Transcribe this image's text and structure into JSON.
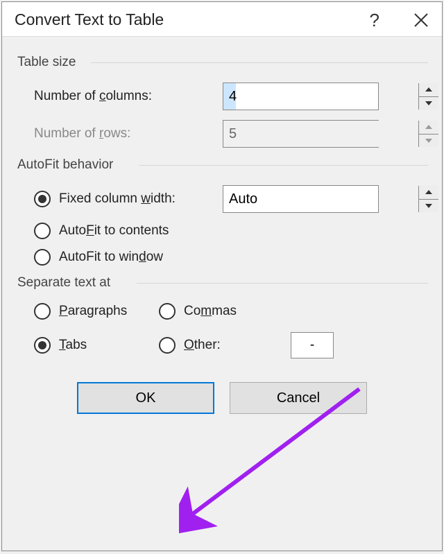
{
  "title": "Convert Text to Table",
  "groups": {
    "table_size": {
      "label": "Table size",
      "columns_label_parts": [
        "Number of ",
        "c",
        "olumns:"
      ],
      "columns_value": "4",
      "rows_label_parts": [
        "Number of ",
        "r",
        "ows:"
      ],
      "rows_value": "5"
    },
    "autofit": {
      "label": "AutoFit behavior",
      "fixed_label_parts": [
        "Fixed column ",
        "w",
        "idth:"
      ],
      "fixed_value": "Auto",
      "contents_label_parts": [
        "Auto",
        "F",
        "it to contents"
      ],
      "window_label_parts": [
        "AutoFit to win",
        "d",
        "ow"
      ]
    },
    "separate": {
      "label": "Separate text at",
      "paragraphs_parts": [
        "",
        "P",
        "aragraphs"
      ],
      "commas_parts": [
        "Co",
        "m",
        "mas"
      ],
      "tabs_parts": [
        "",
        "T",
        "abs"
      ],
      "other_parts": [
        "",
        "O",
        "ther:"
      ],
      "other_value": "-"
    }
  },
  "buttons": {
    "ok": "OK",
    "cancel": "Cancel"
  },
  "titlebar": {
    "help": "?"
  }
}
